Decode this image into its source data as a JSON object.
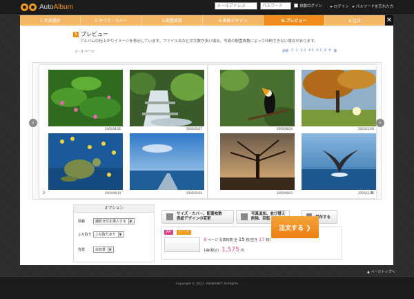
{
  "header": {
    "logo_text_a": "Auto",
    "logo_text_b": "Album",
    "email_placeholder": "メールアドレス",
    "password_placeholder": "パスワード",
    "remember_label": "自動ログイン",
    "login_link": "▸ ログイン",
    "forgot_link": "▸ パスワードを忘れた方"
  },
  "steps": [
    {
      "label": "1.写真選択"
    },
    {
      "label": "2.サイズ・カバー"
    },
    {
      "label": "3.配置枚数"
    },
    {
      "label": "4.表紙デザイン"
    },
    {
      "label": "5.プレビュー"
    },
    {
      "label": "6.注文"
    }
  ],
  "close_label": "✕",
  "section": {
    "number": "5",
    "title": "プレビュー",
    "description": "アルバムの仕上がりイメージを表示しています。ファイル名など文字数が多い場合、写真の配置枚数によって印刷できない場合があります。",
    "page_info": "2 - 3 ページ"
  },
  "pager": [
    "表紙",
    "1",
    "1",
    "2-3",
    "4-5",
    "6-7",
    "8",
    "9",
    "裏"
  ],
  "album": {
    "left_page_number": "2",
    "right_page_number": "3",
    "dates": [
      "2005/04/26",
      "2005/05/27",
      "2005/06/10",
      "2005/05/10",
      "2005/08/24",
      "2005/11/06",
      "2005/09/03",
      "2005/11/20"
    ],
    "prev_arrow": "‹",
    "next_arrow": "›"
  },
  "options": {
    "title": "オプション",
    "rows": [
      {
        "label": "情報",
        "value": "撮影日付を挿入する"
      },
      {
        "label": "ふち取り",
        "value": "ふち取りあり"
      },
      {
        "label": "背景",
        "value": "白背景"
      }
    ]
  },
  "actions": {
    "change_btn_line1": "サイズ・カバー、配置枚数",
    "change_btn_line2": "表紙デザインの変更",
    "edit_btn_line1": "写真追加、並び替え",
    "edit_btn_line2": "削除、回転",
    "save_btn": "保存する"
  },
  "order": {
    "tag_size": "A4",
    "tag_cover": "ハード",
    "pages": "8",
    "pages_unit": "ページ",
    "photos_label": "写真枚数 全",
    "photos_total": "15",
    "photos_unit": "枚(空き",
    "photos_free": "17",
    "photos_end": "枚)",
    "qty_label": "1冊(税込)",
    "price": "1,575",
    "price_unit": "円",
    "order_btn": "注文する ❯"
  },
  "footer": {
    "pagetop": "▲ ページトップへ",
    "copyright": "Copyright © 2011. ASUKANET All Rights"
  }
}
